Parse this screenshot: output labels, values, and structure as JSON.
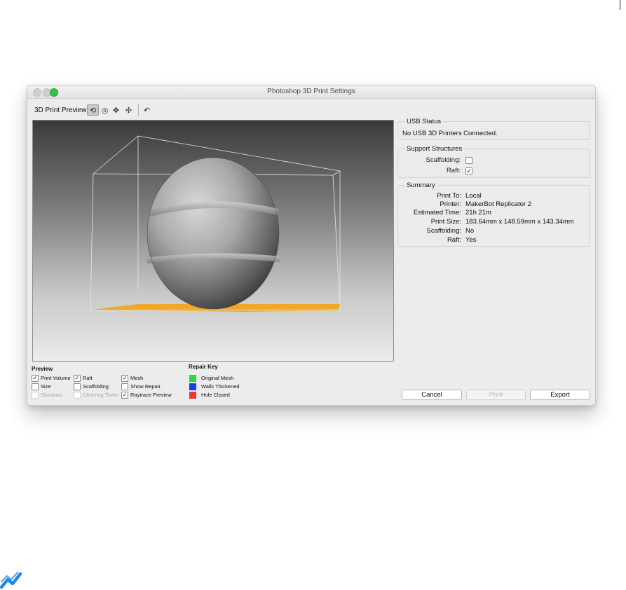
{
  "window": {
    "title": "Photoshop 3D Print Settings"
  },
  "toolbar": {
    "label": "3D Print Preview",
    "tools": [
      {
        "icon": "rotate-scene-icon",
        "glyph": "⟲",
        "active": true
      },
      {
        "icon": "roll-icon",
        "glyph": "◎",
        "active": false
      },
      {
        "icon": "pan-icon",
        "glyph": "✥",
        "active": false
      },
      {
        "icon": "slide-icon",
        "glyph": "✣",
        "active": false
      },
      {
        "icon": "reset-view-icon",
        "glyph": "↶",
        "active": false
      }
    ]
  },
  "usb": {
    "title": "USB Status",
    "message": "No USB 3D Printers Connected."
  },
  "support": {
    "title": "Support Structures",
    "scaffolding_label": "Scaffolding:",
    "scaffolding_checked": false,
    "raft_label": "Raft:",
    "raft_checked": true
  },
  "summary": {
    "title": "Summary",
    "rows": [
      {
        "label": "Print To:",
        "value": "Local"
      },
      {
        "label": "Printer:",
        "value": "MakerBot Replicator 2"
      },
      {
        "label": "Estimated Time:",
        "value": "21h 21m"
      },
      {
        "label": "Print Size:",
        "value": "183.64mm x 148.59mm x 143.34mm"
      },
      {
        "label": "Scaffolding:",
        "value": "No"
      },
      {
        "label": "Raft:",
        "value": "Yes"
      }
    ]
  },
  "preview_options": {
    "title": "Preview",
    "items": [
      {
        "label": "Print Volume",
        "checked": true,
        "disabled": false
      },
      {
        "label": "Raft",
        "checked": true,
        "disabled": false
      },
      {
        "label": "Mesh",
        "checked": true,
        "disabled": false
      },
      {
        "label": "Size",
        "checked": false,
        "disabled": false
      },
      {
        "label": "Scaffolding",
        "checked": false,
        "disabled": false
      },
      {
        "label": "Show Repair",
        "checked": false,
        "disabled": false
      },
      {
        "label": "Shadows",
        "checked": false,
        "disabled": true
      },
      {
        "label": "Cleaning Tower",
        "checked": false,
        "disabled": true
      },
      {
        "label": "Raytrace Preview",
        "checked": true,
        "disabled": false
      }
    ]
  },
  "repair_key": {
    "title": "Repair Key",
    "items": [
      {
        "label": "Original Mesh",
        "color": "#22dd44"
      },
      {
        "label": "Walls Thickened",
        "color": "#1a3ee0"
      },
      {
        "label": "Hole Closed",
        "color": "#e8392b"
      }
    ]
  },
  "buttons": {
    "cancel": "Cancel",
    "print": "Print",
    "export": "Export"
  },
  "colors": {
    "raft": "#f0a72a",
    "accent_green": "#2ac845",
    "logo_blue": "#1e88e5"
  }
}
